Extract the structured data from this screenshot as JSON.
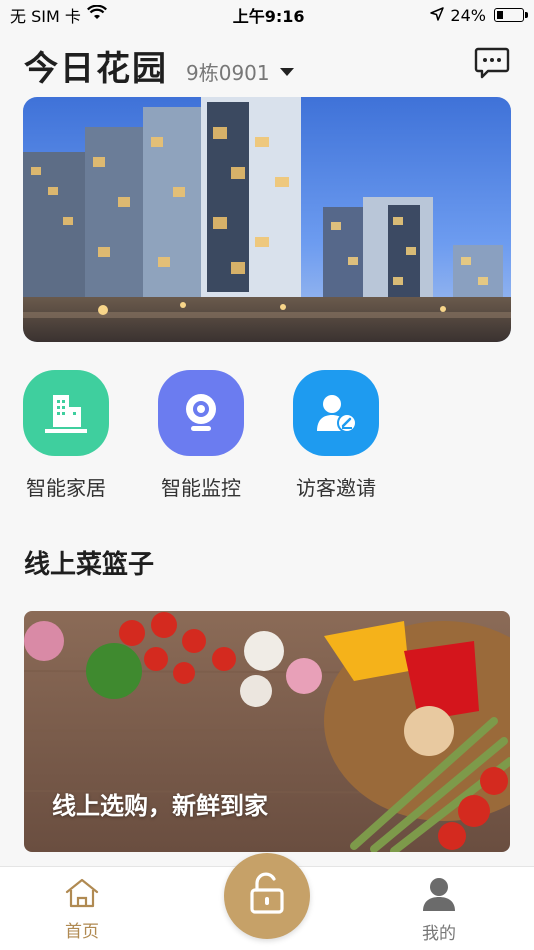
{
  "status_bar": {
    "carrier": "无 SIM 卡",
    "time": "上午9:16",
    "battery": "24%",
    "wifi_icon": "wifi-icon",
    "location_icon": "location-arrow-icon",
    "battery_icon": "battery-icon"
  },
  "header": {
    "title": "今日花园",
    "building": "9栋0901",
    "message_icon": "chat-bubble-icon"
  },
  "features": [
    {
      "label": "智能家居",
      "icon": "building-icon",
      "color": "#3fcf9e"
    },
    {
      "label": "智能监控",
      "icon": "camera-icon",
      "color": "#6b7cf0"
    },
    {
      "label": "访客邀请",
      "icon": "visitor-icon",
      "color": "#1e9bf0"
    }
  ],
  "section": {
    "title": "线上菜篮子",
    "banner_caption": "线上选购，新鲜到家"
  },
  "tabbar": {
    "home_label": "首页",
    "me_label": "我的",
    "home_icon": "home-icon",
    "unlock_icon": "unlock-icon",
    "me_icon": "user-icon"
  },
  "colors": {
    "accent": "#c6a168",
    "tab_active": "#b08a52"
  }
}
